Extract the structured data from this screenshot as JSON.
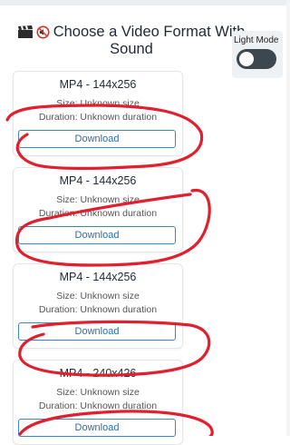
{
  "page": {
    "title": "Choose a Video Format With Sound",
    "title_icons": [
      "clapperboard-icon",
      "muted-speaker-icon"
    ]
  },
  "theme_toggle": {
    "label": "Light Mode"
  },
  "formats": [
    {
      "title": "MP4 - 144x256",
      "size": "Size: Unknown size",
      "duration": "Duration: Unknown duration",
      "button": "Download"
    },
    {
      "title": "MP4 - 144x256",
      "size": "Size: Unknown size",
      "duration": "Duration: Unknown duration",
      "button": "Download"
    },
    {
      "title": "MP4 - 144x256",
      "size": "Size: Unknown size",
      "duration": "Duration: Unknown duration",
      "button": "Download"
    },
    {
      "title": "MP4 - 240x426",
      "size": "Size: Unknown size",
      "duration": "Duration: Unknown duration",
      "button": "Download"
    }
  ],
  "colors": {
    "accent": "#3a86c8",
    "annotation": "#e0202e"
  }
}
